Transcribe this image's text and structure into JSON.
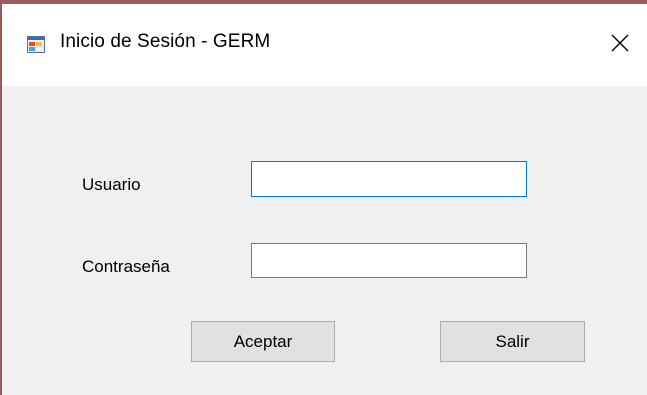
{
  "window": {
    "title": "Inicio de Sesión - GERM",
    "icon": "windows-form-icon",
    "close_icon": "close-icon"
  },
  "form": {
    "user_label": "Usuario",
    "user_value": "",
    "password_label": "Contraseña",
    "password_value": "",
    "accept_label": "Aceptar",
    "exit_label": "Salir"
  },
  "colors": {
    "focus_border": "#0078d7",
    "client_bg": "#f0f0f0",
    "button_bg": "#e1e1e1"
  }
}
